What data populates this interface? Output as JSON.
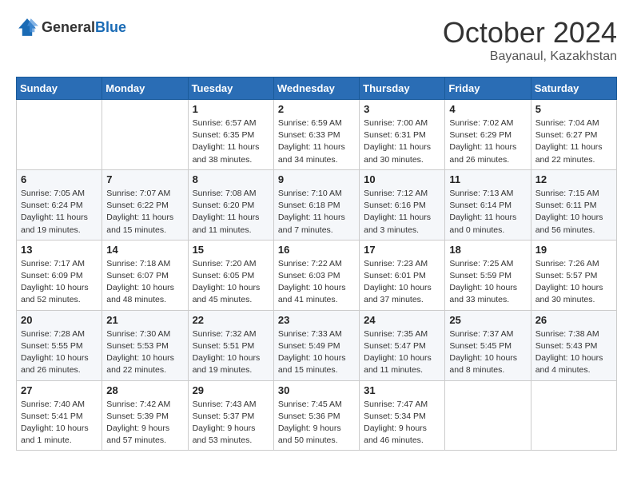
{
  "logo": {
    "general": "General",
    "blue": "Blue"
  },
  "title": {
    "month": "October 2024",
    "location": "Bayanaul, Kazakhstan"
  },
  "headers": [
    "Sunday",
    "Monday",
    "Tuesday",
    "Wednesday",
    "Thursday",
    "Friday",
    "Saturday"
  ],
  "weeks": [
    [
      {
        "day": "",
        "sunrise": "",
        "sunset": "",
        "daylight": ""
      },
      {
        "day": "",
        "sunrise": "",
        "sunset": "",
        "daylight": ""
      },
      {
        "day": "1",
        "sunrise": "Sunrise: 6:57 AM",
        "sunset": "Sunset: 6:35 PM",
        "daylight": "Daylight: 11 hours and 38 minutes."
      },
      {
        "day": "2",
        "sunrise": "Sunrise: 6:59 AM",
        "sunset": "Sunset: 6:33 PM",
        "daylight": "Daylight: 11 hours and 34 minutes."
      },
      {
        "day": "3",
        "sunrise": "Sunrise: 7:00 AM",
        "sunset": "Sunset: 6:31 PM",
        "daylight": "Daylight: 11 hours and 30 minutes."
      },
      {
        "day": "4",
        "sunrise": "Sunrise: 7:02 AM",
        "sunset": "Sunset: 6:29 PM",
        "daylight": "Daylight: 11 hours and 26 minutes."
      },
      {
        "day": "5",
        "sunrise": "Sunrise: 7:04 AM",
        "sunset": "Sunset: 6:27 PM",
        "daylight": "Daylight: 11 hours and 22 minutes."
      }
    ],
    [
      {
        "day": "6",
        "sunrise": "Sunrise: 7:05 AM",
        "sunset": "Sunset: 6:24 PM",
        "daylight": "Daylight: 11 hours and 19 minutes."
      },
      {
        "day": "7",
        "sunrise": "Sunrise: 7:07 AM",
        "sunset": "Sunset: 6:22 PM",
        "daylight": "Daylight: 11 hours and 15 minutes."
      },
      {
        "day": "8",
        "sunrise": "Sunrise: 7:08 AM",
        "sunset": "Sunset: 6:20 PM",
        "daylight": "Daylight: 11 hours and 11 minutes."
      },
      {
        "day": "9",
        "sunrise": "Sunrise: 7:10 AM",
        "sunset": "Sunset: 6:18 PM",
        "daylight": "Daylight: 11 hours and 7 minutes."
      },
      {
        "day": "10",
        "sunrise": "Sunrise: 7:12 AM",
        "sunset": "Sunset: 6:16 PM",
        "daylight": "Daylight: 11 hours and 3 minutes."
      },
      {
        "day": "11",
        "sunrise": "Sunrise: 7:13 AM",
        "sunset": "Sunset: 6:14 PM",
        "daylight": "Daylight: 11 hours and 0 minutes."
      },
      {
        "day": "12",
        "sunrise": "Sunrise: 7:15 AM",
        "sunset": "Sunset: 6:11 PM",
        "daylight": "Daylight: 10 hours and 56 minutes."
      }
    ],
    [
      {
        "day": "13",
        "sunrise": "Sunrise: 7:17 AM",
        "sunset": "Sunset: 6:09 PM",
        "daylight": "Daylight: 10 hours and 52 minutes."
      },
      {
        "day": "14",
        "sunrise": "Sunrise: 7:18 AM",
        "sunset": "Sunset: 6:07 PM",
        "daylight": "Daylight: 10 hours and 48 minutes."
      },
      {
        "day": "15",
        "sunrise": "Sunrise: 7:20 AM",
        "sunset": "Sunset: 6:05 PM",
        "daylight": "Daylight: 10 hours and 45 minutes."
      },
      {
        "day": "16",
        "sunrise": "Sunrise: 7:22 AM",
        "sunset": "Sunset: 6:03 PM",
        "daylight": "Daylight: 10 hours and 41 minutes."
      },
      {
        "day": "17",
        "sunrise": "Sunrise: 7:23 AM",
        "sunset": "Sunset: 6:01 PM",
        "daylight": "Daylight: 10 hours and 37 minutes."
      },
      {
        "day": "18",
        "sunrise": "Sunrise: 7:25 AM",
        "sunset": "Sunset: 5:59 PM",
        "daylight": "Daylight: 10 hours and 33 minutes."
      },
      {
        "day": "19",
        "sunrise": "Sunrise: 7:26 AM",
        "sunset": "Sunset: 5:57 PM",
        "daylight": "Daylight: 10 hours and 30 minutes."
      }
    ],
    [
      {
        "day": "20",
        "sunrise": "Sunrise: 7:28 AM",
        "sunset": "Sunset: 5:55 PM",
        "daylight": "Daylight: 10 hours and 26 minutes."
      },
      {
        "day": "21",
        "sunrise": "Sunrise: 7:30 AM",
        "sunset": "Sunset: 5:53 PM",
        "daylight": "Daylight: 10 hours and 22 minutes."
      },
      {
        "day": "22",
        "sunrise": "Sunrise: 7:32 AM",
        "sunset": "Sunset: 5:51 PM",
        "daylight": "Daylight: 10 hours and 19 minutes."
      },
      {
        "day": "23",
        "sunrise": "Sunrise: 7:33 AM",
        "sunset": "Sunset: 5:49 PM",
        "daylight": "Daylight: 10 hours and 15 minutes."
      },
      {
        "day": "24",
        "sunrise": "Sunrise: 7:35 AM",
        "sunset": "Sunset: 5:47 PM",
        "daylight": "Daylight: 10 hours and 11 minutes."
      },
      {
        "day": "25",
        "sunrise": "Sunrise: 7:37 AM",
        "sunset": "Sunset: 5:45 PM",
        "daylight": "Daylight: 10 hours and 8 minutes."
      },
      {
        "day": "26",
        "sunrise": "Sunrise: 7:38 AM",
        "sunset": "Sunset: 5:43 PM",
        "daylight": "Daylight: 10 hours and 4 minutes."
      }
    ],
    [
      {
        "day": "27",
        "sunrise": "Sunrise: 7:40 AM",
        "sunset": "Sunset: 5:41 PM",
        "daylight": "Daylight: 10 hours and 1 minute."
      },
      {
        "day": "28",
        "sunrise": "Sunrise: 7:42 AM",
        "sunset": "Sunset: 5:39 PM",
        "daylight": "Daylight: 9 hours and 57 minutes."
      },
      {
        "day": "29",
        "sunrise": "Sunrise: 7:43 AM",
        "sunset": "Sunset: 5:37 PM",
        "daylight": "Daylight: 9 hours and 53 minutes."
      },
      {
        "day": "30",
        "sunrise": "Sunrise: 7:45 AM",
        "sunset": "Sunset: 5:36 PM",
        "daylight": "Daylight: 9 hours and 50 minutes."
      },
      {
        "day": "31",
        "sunrise": "Sunrise: 7:47 AM",
        "sunset": "Sunset: 5:34 PM",
        "daylight": "Daylight: 9 hours and 46 minutes."
      },
      {
        "day": "",
        "sunrise": "",
        "sunset": "",
        "daylight": ""
      },
      {
        "day": "",
        "sunrise": "",
        "sunset": "",
        "daylight": ""
      }
    ]
  ]
}
